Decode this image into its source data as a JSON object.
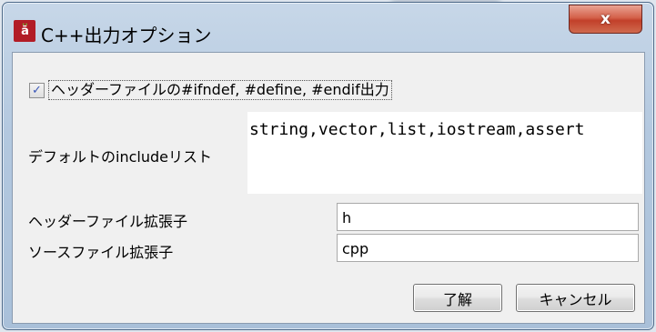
{
  "window": {
    "title": "C++出力オプション",
    "icon": "app-icon",
    "close_symbol": "x"
  },
  "options": {
    "checkbox_label": "ヘッダーファイルの#ifndef, #define, #endif出力",
    "checkbox_checked": true,
    "checkmark": "✓",
    "include_list_label": "デフォルトのincludeリスト",
    "include_list_value": "string,vector,list,iostream,assert",
    "header_ext_label": "ヘッダーファイル拡張子",
    "header_ext_value": "h",
    "source_ext_label": "ソースファイル拡張子",
    "source_ext_value": "cpp"
  },
  "buttons": {
    "ok": "了解",
    "cancel": "キャンセル"
  },
  "colors": {
    "close_button": "#c7432e",
    "title_bar": "#b9cde2",
    "dialog_bg": "#f0f0f0",
    "checkmark": "#3a57b8"
  }
}
